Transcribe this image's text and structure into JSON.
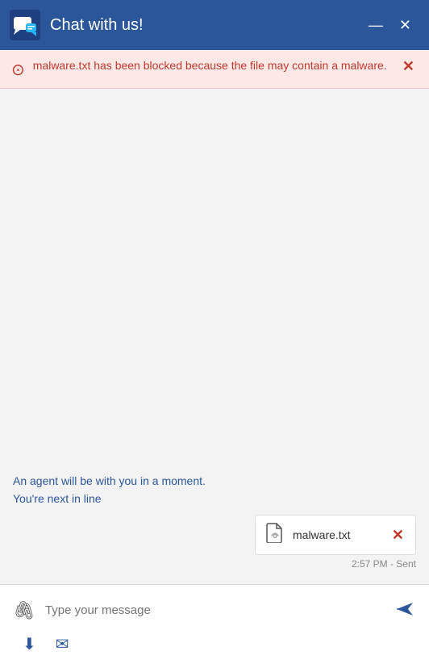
{
  "titlebar": {
    "title": "Chat with us!",
    "minimize_label": "—",
    "close_label": "✕"
  },
  "warning": {
    "text": "malware.txt has been blocked because the file may contain a malware.",
    "close_label": "✕"
  },
  "chat": {
    "agent_message": "An agent will be with you in a moment.",
    "queue_message": "You're next in line"
  },
  "attachment": {
    "file_name": "malware.txt",
    "remove_label": "✕"
  },
  "timestamp": {
    "value": "2:57 PM - Sent"
  },
  "input": {
    "placeholder": "Type your message",
    "send_label": "Send"
  },
  "icons": {
    "attach": "📎",
    "download": "⬇",
    "email": "✉"
  }
}
